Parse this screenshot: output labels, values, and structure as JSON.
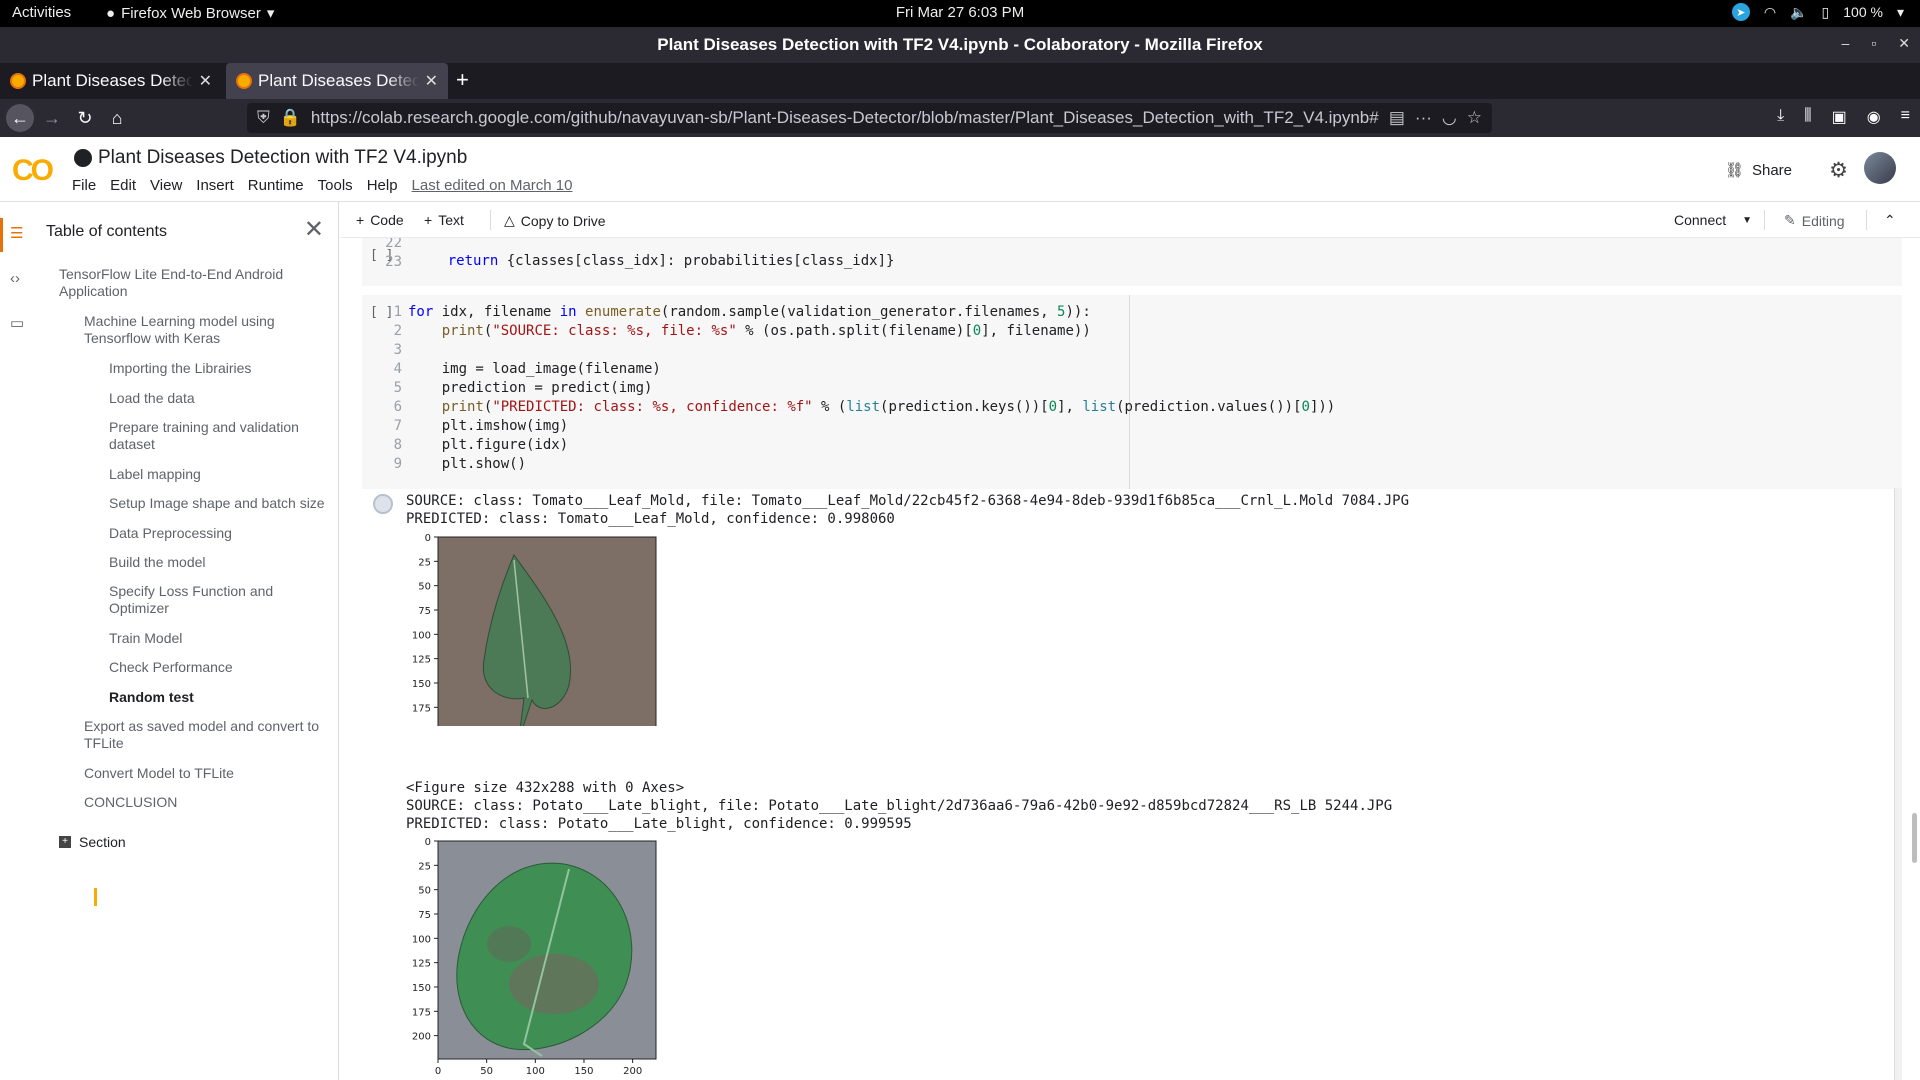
{
  "system": {
    "activities": "Activities",
    "app_name": "Firefox Web Browser",
    "clock": "Fri Mar 27  6:03 PM",
    "battery": "100 %"
  },
  "window": {
    "title": "Plant Diseases Detection with TF2 V4.ipynb - Colaboratory - Mozilla Firefox"
  },
  "tabs": [
    {
      "label": "Plant Diseases Detecti"
    },
    {
      "label": "Plant Diseases Detecti"
    }
  ],
  "nav": {
    "url": "https://colab.research.google.com/github/navayuvan-sb/Plant-Diseases-Detector/blob/master/Plant_Diseases_Detection_with_TF2_V4.ipynb#scrollTo=QU"
  },
  "colab": {
    "notebook_title": "Plant Diseases Detection with TF2  V4.ipynb",
    "menu": [
      "File",
      "Edit",
      "View",
      "Insert",
      "Runtime",
      "Tools",
      "Help"
    ],
    "last_edited": "Last edited on March 10",
    "share": "Share"
  },
  "toc": {
    "heading": "Table of contents",
    "items": [
      {
        "label": "TensorFlow Lite End-to-End Android Application",
        "level": 1
      },
      {
        "label": "Machine Learning model using Tensorflow with Keras",
        "level": 2
      },
      {
        "label": "Importing the Librairies",
        "level": 3
      },
      {
        "label": "Load the data",
        "level": 3
      },
      {
        "label": "Prepare training and validation dataset",
        "level": 3
      },
      {
        "label": "Label mapping",
        "level": 3
      },
      {
        "label": "Setup Image shape and batch size",
        "level": 3
      },
      {
        "label": "Data Preprocessing",
        "level": 3
      },
      {
        "label": "Build the model",
        "level": 3
      },
      {
        "label": "Specify Loss Function and Optimizer",
        "level": 3
      },
      {
        "label": "Train Model",
        "level": 3
      },
      {
        "label": "Check Performance",
        "level": 3
      },
      {
        "label": "Random test",
        "level": 3
      },
      {
        "label": "Export as saved model and convert to TFLite",
        "level": 2
      },
      {
        "label": "Convert Model to TFLite",
        "level": 2
      },
      {
        "label": "CONCLUSION",
        "level": 2
      }
    ],
    "section_button": "Section"
  },
  "toolbar": {
    "code": "Code",
    "text": "Text",
    "copy_to_drive": "Copy to Drive",
    "connect": "Connect",
    "editing": "Editing"
  },
  "cells": {
    "run_label": "[ ]",
    "cell1_gutter": "22\n23",
    "cell2_gutter": "1\n2\n3\n4\n5\n6\n7\n8\n9"
  },
  "outputs": {
    "source1": "SOURCE: class: Tomato___Leaf_Mold, file: Tomato___Leaf_Mold/22cb45f2-6368-4e94-8deb-939d1f6b85ca___Crnl_L.Mold 7084.JPG",
    "predicted1": "PREDICTED: class: Tomato___Leaf_Mold, confidence: 0.998060",
    "figure_note": "<Figure size 432x288 with 0 Axes>",
    "source2": "SOURCE: class: Potato___Late_blight, file: Potato___Late_blight/2d736aa6-79a6-42b0-9e92-d859bcd72824___RS_LB 5244.JPG",
    "predicted2": "PREDICTED: class: Potato___Late_blight, confidence: 0.999595",
    "ytick_labels": [
      "0",
      "25",
      "50",
      "75",
      "100",
      "125",
      "150",
      "175",
      "200"
    ],
    "xtick_labels": [
      "0",
      "50",
      "100",
      "150",
      "200"
    ]
  }
}
